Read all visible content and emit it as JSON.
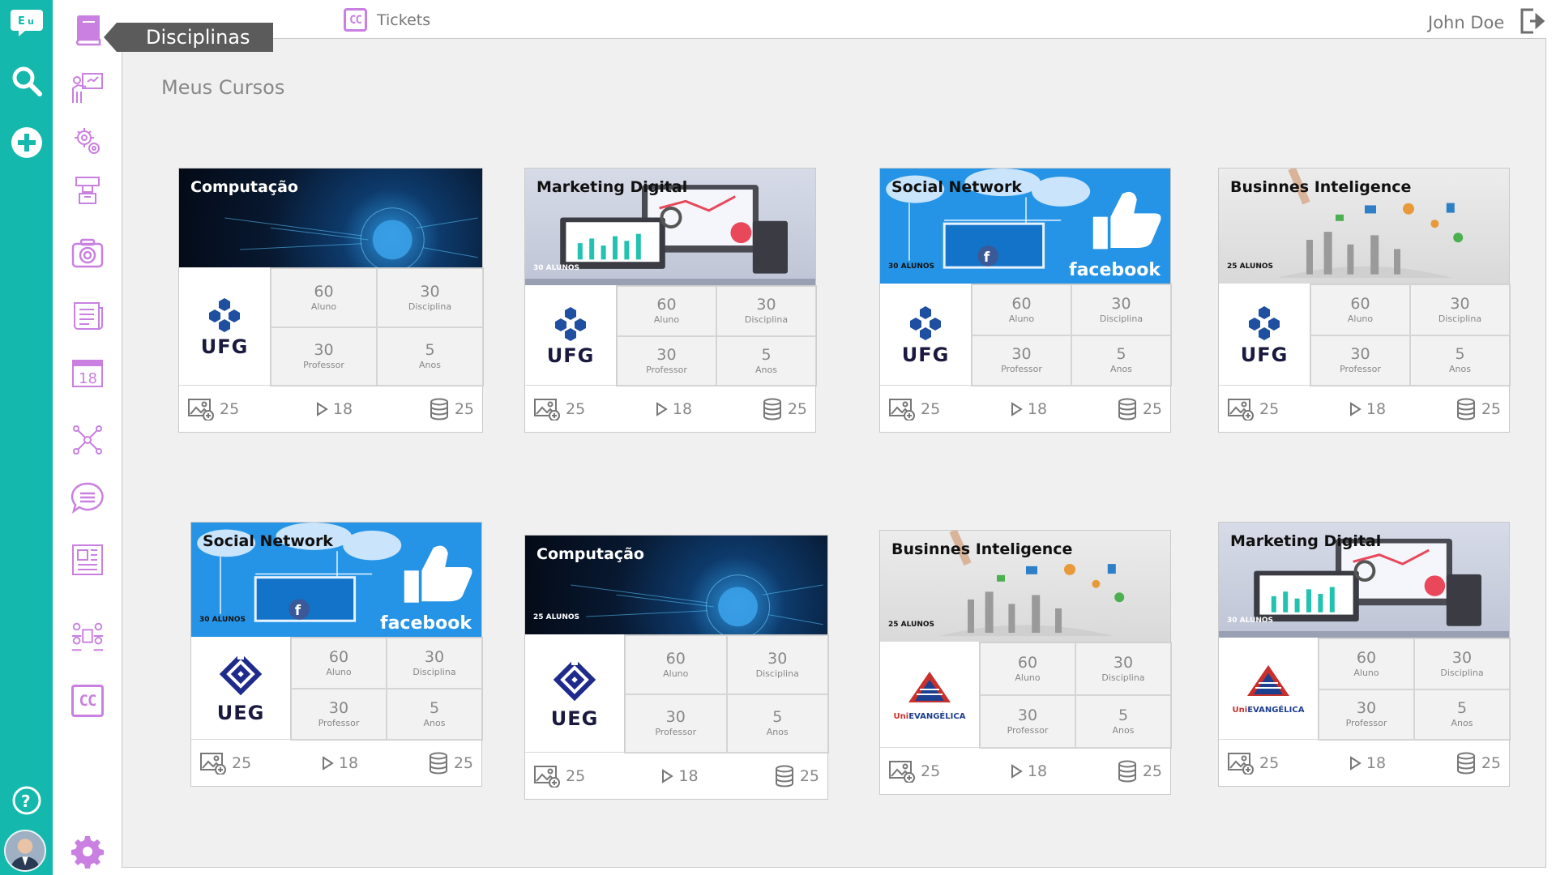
{
  "header": {
    "active_tab": "Disciplinas",
    "tickets_tab": "Tickets",
    "tickets_icon": "CC",
    "username": "John Doe"
  },
  "main": {
    "section_title": "Meus Cursos"
  },
  "sidebar": {
    "rail": [
      "chat-logo-icon",
      "search-icon",
      "add-icon",
      "help-icon",
      "avatar"
    ],
    "items": [
      "book-icon",
      "presentation-icon",
      "settings-icon",
      "workshop-icon",
      "camera-icon",
      "news-icon",
      "calendar-icon",
      "network-icon",
      "chat-list-icon",
      "document-icon",
      "meeting-icon",
      "tickets-icon",
      "gear-icon"
    ],
    "calendar_day": "18",
    "accent": "#14b8ad",
    "icon_color": "#c980e0"
  },
  "courses": [
    {
      "title": "Computação",
      "institution": "UFG",
      "students_label": "",
      "stats": {
        "aluno": "60",
        "aluno_label": "Aluno",
        "disciplina": "30",
        "disciplina_label": "Disciplina",
        "professor": "30",
        "professor_label": "Professor",
        "anos": "5",
        "anos_label": "Anos"
      },
      "footer": {
        "images": "25",
        "videos": "18",
        "storage": "25"
      }
    },
    {
      "title": "Marketing Digital",
      "institution": "UFG",
      "students_label": "30 ALUNOS",
      "stats": {
        "aluno": "60",
        "aluno_label": "Aluno",
        "disciplina": "30",
        "disciplina_label": "Disciplina",
        "professor": "30",
        "professor_label": "Professor",
        "anos": "5",
        "anos_label": "Anos"
      },
      "footer": {
        "images": "25",
        "videos": "18",
        "storage": "25"
      }
    },
    {
      "title": "Social Network",
      "institution": "UFG",
      "students_label": "30 ALUNOS",
      "banner_caption": "facebook",
      "stats": {
        "aluno": "60",
        "aluno_label": "Aluno",
        "disciplina": "30",
        "disciplina_label": "Disciplina",
        "professor": "30",
        "professor_label": "Professor",
        "anos": "5",
        "anos_label": "Anos"
      },
      "footer": {
        "images": "25",
        "videos": "18",
        "storage": "25"
      }
    },
    {
      "title": "Businnes Inteligence",
      "institution": "UFG",
      "students_label": "25 ALUNOS",
      "stats": {
        "aluno": "60",
        "aluno_label": "Aluno",
        "disciplina": "30",
        "disciplina_label": "Disciplina",
        "professor": "30",
        "professor_label": "Professor",
        "anos": "5",
        "anos_label": "Anos"
      },
      "footer": {
        "images": "25",
        "videos": "18",
        "storage": "25"
      }
    },
    {
      "title": "Social Network",
      "institution": "UEG",
      "students_label": "30 ALUNOS",
      "banner_caption": "facebook",
      "stats": {
        "aluno": "60",
        "aluno_label": "Aluno",
        "disciplina": "30",
        "disciplina_label": "Disciplina",
        "professor": "30",
        "professor_label": "Professor",
        "anos": "5",
        "anos_label": "Anos"
      },
      "footer": {
        "images": "25",
        "videos": "18",
        "storage": "25"
      }
    },
    {
      "title": "Computação",
      "institution": "UEG",
      "students_label": "25 ALUNOS",
      "stats": {
        "aluno": "60",
        "aluno_label": "Aluno",
        "disciplina": "30",
        "disciplina_label": "Disciplina",
        "professor": "30",
        "professor_label": "Professor",
        "anos": "5",
        "anos_label": "Anos"
      },
      "footer": {
        "images": "25",
        "videos": "18",
        "storage": "25"
      }
    },
    {
      "title": "Businnes Inteligence",
      "institution": "UniEVANGÉLICA",
      "students_label": "25 ALUNOS",
      "stats": {
        "aluno": "60",
        "aluno_label": "Aluno",
        "disciplina": "30",
        "disciplina_label": "Disciplina",
        "professor": "30",
        "professor_label": "Professor",
        "anos": "5",
        "anos_label": "Anos"
      },
      "footer": {
        "images": "25",
        "videos": "18",
        "storage": "25"
      }
    },
    {
      "title": "Marketing Digital",
      "institution": "UniEVANGÉLICA",
      "students_label": "30 ALUNOS",
      "stats": {
        "aluno": "60",
        "aluno_label": "Aluno",
        "disciplina": "30",
        "disciplina_label": "Disciplina",
        "professor": "30",
        "professor_label": "Professor",
        "anos": "5",
        "anos_label": "Anos"
      },
      "footer": {
        "images": "25",
        "videos": "18",
        "storage": "25"
      }
    }
  ]
}
